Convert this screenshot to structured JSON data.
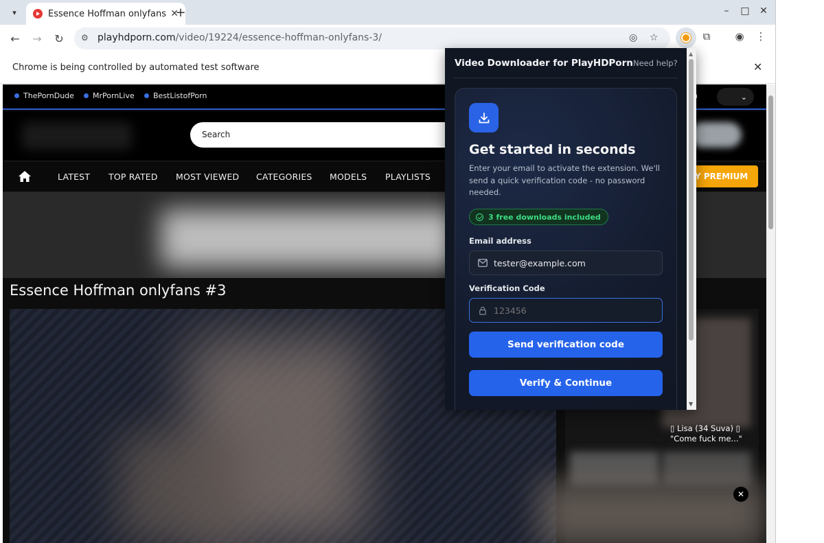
{
  "browser": {
    "tab_title": "Essence Hoffman onlyfans",
    "url_host": "playhdporn.com",
    "url_path": "/video/19224/essence-hoffman-onlyfans-3/",
    "infobar_text": "Chrome is being controlled by automated test software"
  },
  "page": {
    "top_links": [
      "ThePornDude",
      "MrPornLive",
      "BestListofPorn"
    ],
    "lang_partial": "n",
    "search_placeholder": "Search",
    "nav_items": [
      "LATEST",
      "TOP RATED",
      "MOST VIEWED",
      "CATEGORIES",
      "MODELS",
      "PLAYLISTS"
    ],
    "premium_label": "Y PREMIUM",
    "video_title": "Essence Hoffman onlyfans #3",
    "side_caption": "▯ Lisa (34 Suva) ▯ \"Come fuck me...\"",
    "close_glyph": "✕"
  },
  "popup": {
    "title": "Video Downloader for PlayHDPorn",
    "help": "Need help?",
    "heading": "Get started in seconds",
    "description": "Enter your email to activate the extension. We'll send a quick verification code - no password needed.",
    "badge": "3 free downloads included",
    "email_label": "Email address",
    "email_value": "tester@example.com",
    "code_label": "Verification Code",
    "code_placeholder": "123456",
    "send_button": "Send verification code",
    "verify_button": "Verify & Continue"
  },
  "colors": {
    "accent": "#2563eb",
    "badge_green": "#3ddc84",
    "premium": "#f6a609",
    "popup_bg": "#111623"
  }
}
